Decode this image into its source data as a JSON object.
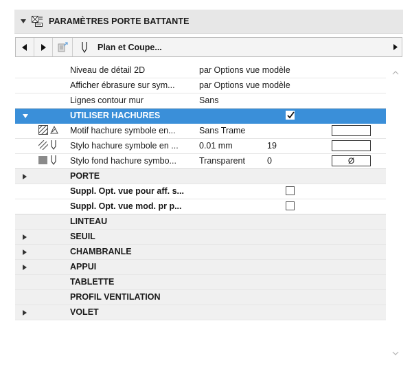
{
  "header": {
    "title": "PARAMÈTRES PORTE BATTANTE"
  },
  "toolbar": {
    "view_label": "Plan et Coupe..."
  },
  "rows": [
    {
      "name": "Niveau de détail 2D",
      "value": "par Options vue modèle"
    },
    {
      "name": "Afficher ébrasure sur sym...",
      "value": "par Options vue modèle"
    },
    {
      "name": "Lignes contour mur",
      "value": "Sans"
    },
    {
      "name": "UTILISER HACHURES",
      "checked": true
    },
    {
      "name": "Motif hachure symbole en...",
      "value": "Sans Trame"
    },
    {
      "name": "Stylo hachure symbole en ...",
      "value": "0.01 mm",
      "number": "19"
    },
    {
      "name": "Stylo fond hachure symbo...",
      "value": "Transparent",
      "number": "0",
      "swatch": "Ø"
    },
    {
      "name": "PORTE"
    },
    {
      "name": "Suppl. Opt. vue pour aff. s...",
      "checked": false
    },
    {
      "name": "Suppl. Opt. vue mod. pr p...",
      "checked": false
    },
    {
      "name": "LINTEAU"
    },
    {
      "name": "SEUIL"
    },
    {
      "name": "CHAMBRANLE"
    },
    {
      "name": "APPUI"
    },
    {
      "name": "TABLETTE"
    },
    {
      "name": "PROFIL VENTILATION"
    },
    {
      "name": "VOLET"
    }
  ],
  "colors": {
    "selected_row": "#3a8fd9",
    "header_bg": "#e7e7e7"
  },
  "icons": {
    "header": "door-settings-icon",
    "prev": "arrow-left-icon",
    "next": "arrow-right-icon",
    "pen": "pen-icon",
    "more": "arrow-right-icon"
  }
}
